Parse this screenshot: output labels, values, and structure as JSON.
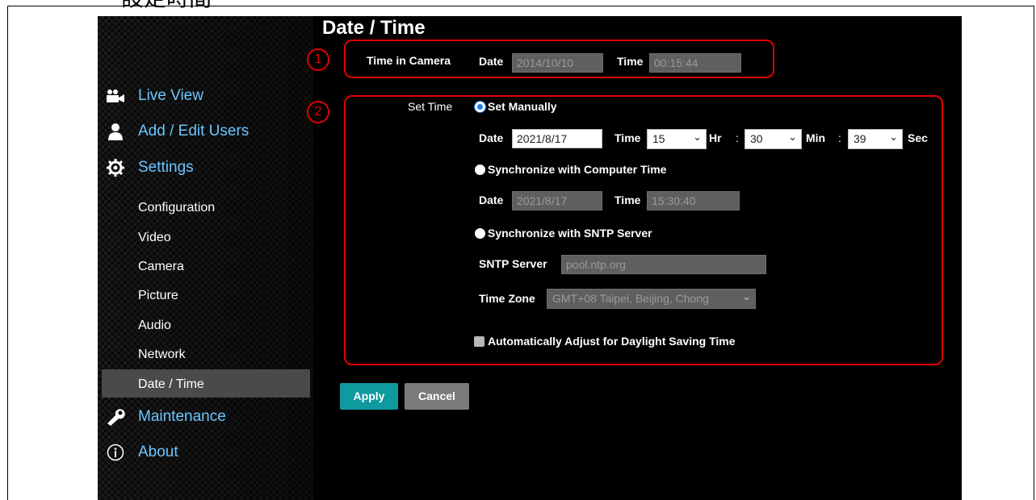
{
  "doc_heading": "設定時間",
  "sidebar": {
    "main_items": [
      {
        "label": "Live View",
        "icon": "video-camera-icon"
      },
      {
        "label": "Add / Edit Users",
        "icon": "user-icon"
      },
      {
        "label": "Settings",
        "icon": "gear-icon"
      },
      {
        "label": "Maintenance",
        "icon": "wrench-icon"
      },
      {
        "label": "About",
        "icon": "info-icon"
      }
    ],
    "sub_items": [
      "Configuration",
      "Video",
      "Camera",
      "Picture",
      "Audio",
      "Network",
      "Date / Time"
    ],
    "active": "Date / Time"
  },
  "page": {
    "title": "Date / Time",
    "annotations": [
      "1",
      "2"
    ],
    "time_in_camera": {
      "label": "Time in Camera",
      "date_label": "Date",
      "date_value": "2014/10/10",
      "time_label": "Time",
      "time_value": "00:15:44"
    },
    "set_time": {
      "label": "Set Time",
      "manual": {
        "label": "Set Manually",
        "date_label": "Date",
        "date_value": "2021/8/17",
        "time_label": "Time",
        "hr_value": "15",
        "hr_label": "Hr",
        "sep": ":",
        "min_value": "30",
        "min_label": "Min",
        "sec_value": "39",
        "sec_label": "Sec"
      },
      "computer": {
        "label": "Synchronize with Computer Time",
        "date_label": "Date",
        "date_value": "2021/8/17",
        "time_label": "Time",
        "time_value": "15:30:40"
      },
      "sntp": {
        "label": "Synchronize with SNTP Server",
        "server_label": "SNTP Server",
        "server_value": "pool.ntp.org",
        "tz_label": "Time Zone",
        "tz_value": "GMT+08 Taipei, Beijing, Chong"
      },
      "dst_label": "Automatically Adjust for Daylight Saving Time"
    },
    "buttons": {
      "apply": "Apply",
      "cancel": "Cancel"
    }
  },
  "colors": {
    "accent_blue": "#6cc6ff",
    "annotation_red": "#e00000",
    "apply": "#0f9aa0"
  }
}
